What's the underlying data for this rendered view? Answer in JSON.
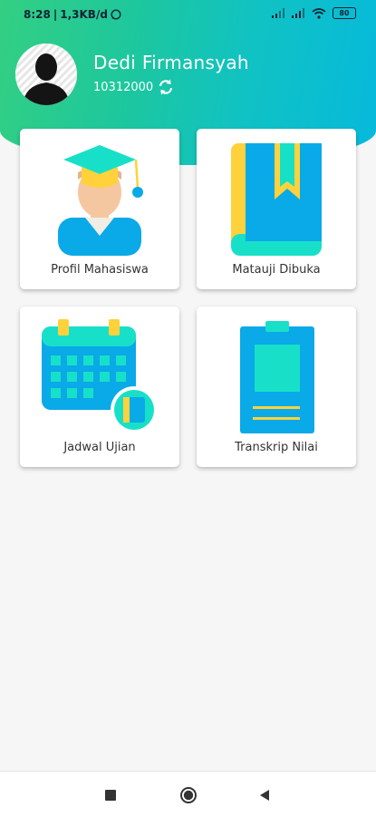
{
  "status_bar": {
    "time": "8:28",
    "speed": "1,3KB/d",
    "battery": "80"
  },
  "profile": {
    "name": "Dedi Firmansyah",
    "id": "10312000"
  },
  "menu": [
    {
      "label": "Profil Mahasiswa",
      "icon": "graduate-icon"
    },
    {
      "label": "Matauji Dibuka",
      "icon": "book-icon"
    },
    {
      "label": "Jadwal Ujian",
      "icon": "calendar-icon"
    },
    {
      "label": "Transkrip Nilai",
      "icon": "clipboard-icon"
    }
  ],
  "colors": {
    "header_start": "#33cf82",
    "header_end": "#06b9dc",
    "accent_blue": "#0aa9e8",
    "accent_teal": "#18e0c8",
    "accent_yellow": "#ffd23c"
  }
}
